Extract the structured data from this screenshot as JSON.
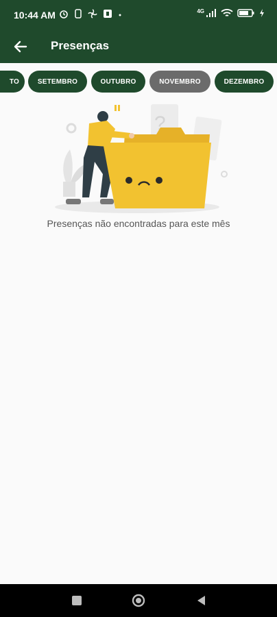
{
  "status_bar": {
    "time": "10:44 AM",
    "network": "4G"
  },
  "app_bar": {
    "title": "Presenças"
  },
  "months": [
    {
      "label": "TO",
      "selected": false
    },
    {
      "label": "SETEMBRO",
      "selected": false
    },
    {
      "label": "OUTUBRO",
      "selected": false
    },
    {
      "label": "NOVEMBRO",
      "selected": true
    },
    {
      "label": "DEZEMBRO",
      "selected": false
    }
  ],
  "empty_state": {
    "message": "Presenças não encontradas para este mês",
    "illustration": "person-with-sad-folder"
  },
  "colors": {
    "primary": "#1f4a2c",
    "chip_selected": "#6b6b6b",
    "folder": "#f2c230",
    "background": "#fafafa"
  }
}
